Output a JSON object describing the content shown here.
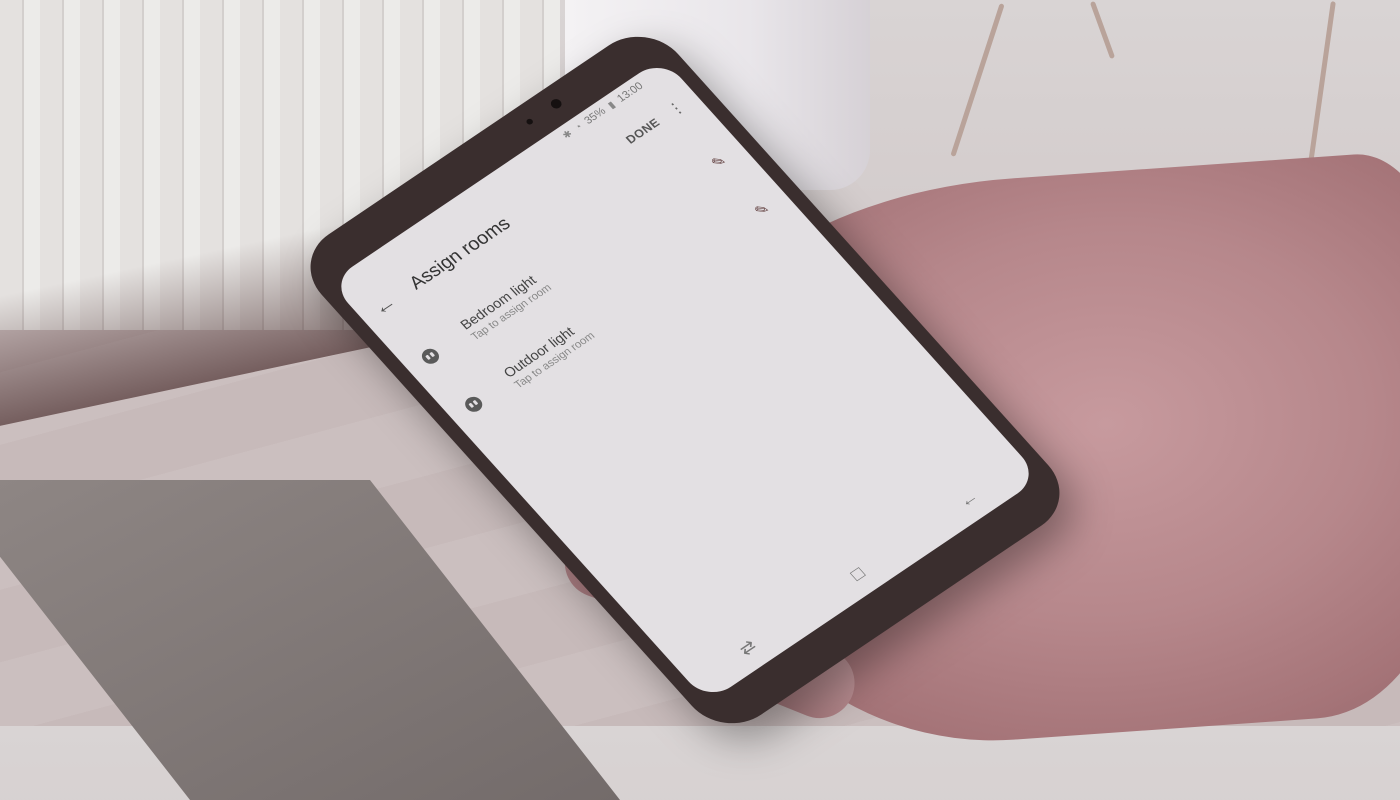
{
  "status_bar": {
    "battery": "35%",
    "time": "13:00"
  },
  "app_bar": {
    "title": "Assign rooms",
    "done_label": "DONE"
  },
  "devices": [
    {
      "name": "Bedroom light",
      "subtitle": "Tap to assign room",
      "icon": "plug-icon",
      "action_icon": "edit-icon"
    },
    {
      "name": "Outdoor light",
      "subtitle": "Tap to assign room",
      "icon": "plug-icon",
      "action_icon": "edit-icon"
    }
  ],
  "nav_bar": {
    "icons": [
      "back-nav-icon",
      "home-nav-icon",
      "recents-nav-icon"
    ]
  }
}
